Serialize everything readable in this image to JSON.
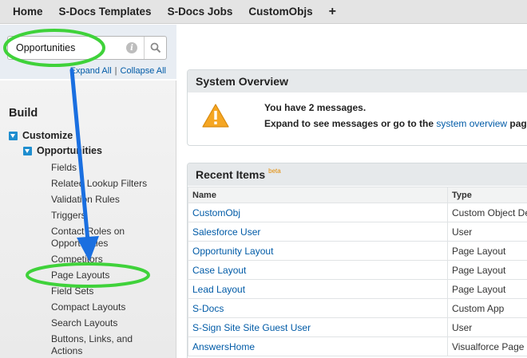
{
  "topnav": {
    "tabs": [
      "Home",
      "S-Docs Templates",
      "S-Docs Jobs",
      "CustomObjs"
    ],
    "plus": "+"
  },
  "sidebar": {
    "search": {
      "value": "Opportunities",
      "info_icon": "info-icon",
      "button_icon": "search-icon"
    },
    "expand_all": "Expand All",
    "separator": "|",
    "collapse_all": "Collapse All",
    "heading": "Build",
    "customize": "Customize",
    "opportunities": "Opportunities",
    "items": [
      "Fields",
      "Related Lookup Filters",
      "Validation Rules",
      "Triggers",
      "Contact Roles on Opportunities",
      "Competitors",
      "Page Layouts",
      "Field Sets",
      "Compact Layouts",
      "Search Layouts",
      "Buttons, Links, and Actions"
    ]
  },
  "system_overview": {
    "title": "System Overview",
    "message_line1": "You have 2 messages.",
    "message_line2_prefix": "Expand to see messages or go to the ",
    "message_link": "system overview",
    "message_line2_suffix": " pag",
    "icon": "warning-icon"
  },
  "recent_items": {
    "title": "Recent Items",
    "beta": "beta",
    "columns": [
      "Name",
      "Type"
    ],
    "rows": [
      {
        "name": "CustomObj",
        "type": "Custom Object De"
      },
      {
        "name": "Salesforce User",
        "type": "User"
      },
      {
        "name": "Opportunity Layout",
        "type": "Page Layout"
      },
      {
        "name": "Case Layout",
        "type": "Page Layout"
      },
      {
        "name": "Lead Layout",
        "type": "Page Layout"
      },
      {
        "name": "S-Docs",
        "type": "Custom App"
      },
      {
        "name": "S-Sign Site Site Guest User",
        "type": "User"
      },
      {
        "name": "AnswersHome",
        "type": "Visualforce Page"
      }
    ]
  },
  "colors": {
    "link": "#015ba7",
    "highlight_green": "#3fd23a",
    "arrow_blue": "#1a6fe0",
    "warning": "#f5a623"
  }
}
